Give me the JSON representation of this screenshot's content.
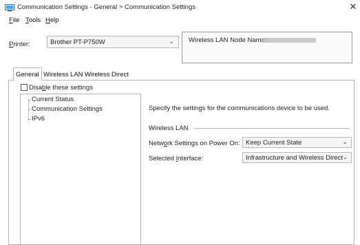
{
  "window": {
    "title": "Communication Settings - General > Communication Settings",
    "close_glyph": "✕"
  },
  "menu": {
    "items": [
      {
        "prefix": "",
        "accel": "F",
        "suffix": "ile"
      },
      {
        "prefix": "",
        "accel": "T",
        "suffix": "ools"
      },
      {
        "prefix": "",
        "accel": "H",
        "suffix": "elp"
      }
    ]
  },
  "printer": {
    "label_accel": "P",
    "label_rest": "rinter:",
    "selected": "Brother PT-P750W",
    "node_label": "Wireless LAN Node Name:"
  },
  "tabs": [
    "General",
    "Wireless LAN",
    "Wireless Direct"
  ],
  "disable": {
    "pre": "Disa",
    "accel": "b",
    "post": "le these settings",
    "checked": false
  },
  "tree": {
    "items": [
      "Current Status",
      "Communication Settings",
      "IPv6"
    ]
  },
  "content": {
    "description": "Specify the settings for the communications device to be used.",
    "group_title": "Wireless LAN",
    "network_label_pre": "Netw",
    "network_label_accel": "o",
    "network_label_post": "rk Settings on Power On:",
    "network_value": "Keep Current State",
    "interface_label_pre": "Selected ",
    "interface_label_accel": "I",
    "interface_label_post": "nterface:",
    "interface_value": "Infrastructure and Wireless Direct"
  },
  "icons": {
    "chevron": "⌄"
  },
  "colors": {
    "accent": "#1a73c9",
    "border": "#b5b5b5"
  }
}
